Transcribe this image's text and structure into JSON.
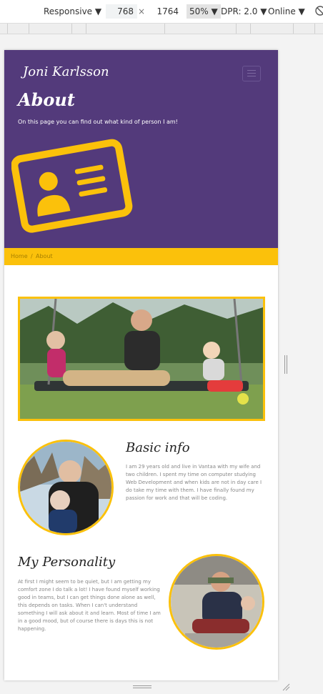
{
  "devtools": {
    "device": "Responsive",
    "width": "768",
    "times": "×",
    "height": "1764",
    "zoom": "50%",
    "dpr": "DPR: 2.0",
    "network": "Online"
  },
  "site": {
    "brand": "Joni Karlsson",
    "hero_title": "About",
    "hero_subtitle": "On this page you can find out what kind of person I am!",
    "breadcrumb": {
      "home": "Home",
      "separator": "/",
      "current": "About"
    },
    "basic_info": {
      "heading": "Basic info",
      "text": "I am 29 years old and live in Vantaa with my wife and two children. I spent my time on computer studying Web Development and when kids are not in day care I do take my time with them. I have finally found my passion for work and that will be coding."
    },
    "personality": {
      "heading": "My Personality",
      "text": "At first I might seem to be quiet, but I am getting my comfort zone I do talk a lot! I have found myself working good in teams, but I can get things done alone as well, this depends on tasks. When I can't understand something I will ask about it and learn. Most of time I am in a good mood, but of course there is days this is not happening."
    }
  },
  "colors": {
    "hero": "#533a7b",
    "accent": "#fbc10b"
  }
}
